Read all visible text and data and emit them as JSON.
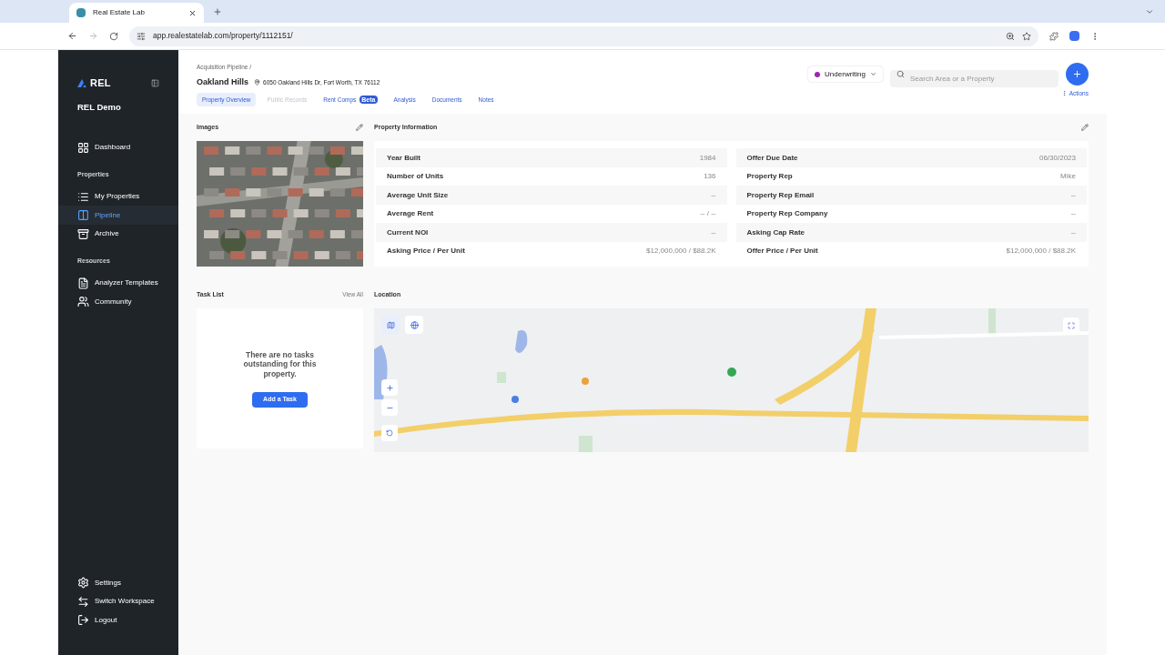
{
  "browser": {
    "tab_title": "Real Estate Lab",
    "url": "app.realestatelab.com/property/1112151/"
  },
  "sidebar": {
    "logo": "REL",
    "workspace": "REL Demo",
    "sections": [
      {
        "items": [
          {
            "label": "Dashboard",
            "selected": false
          }
        ]
      },
      {
        "title": "Properties",
        "items": [
          {
            "label": "My Properties",
            "selected": false
          },
          {
            "label": "Pipeline",
            "selected": true
          },
          {
            "label": "Archive",
            "selected": false
          }
        ]
      },
      {
        "title": "Resources",
        "items": [
          {
            "label": "Analyzer Templates",
            "selected": false
          },
          {
            "label": "Community",
            "selected": false
          }
        ]
      }
    ],
    "bottom": [
      {
        "label": "Settings"
      },
      {
        "label": "Switch Workspace"
      },
      {
        "label": "Logout"
      }
    ]
  },
  "header": {
    "breadcrumb": "Acquisition Pipeline /",
    "title": "Oakland Hills",
    "address": "6050 Oakland Hills Dr, Fort Worth, TX 76112",
    "status": {
      "label": "Underwriting",
      "color": "#9c27b0"
    },
    "search": {
      "placeholder": "Search Area or a Property"
    },
    "actions": "Actions",
    "tabs": [
      {
        "label": "Property Overview",
        "selected": true,
        "disabled": false
      },
      {
        "label": "Public Records",
        "selected": false,
        "disabled": true
      },
      {
        "label": "Rent Comps",
        "badge": "Beta",
        "selected": false,
        "disabled": false
      },
      {
        "label": "Analysis",
        "selected": false,
        "disabled": false
      },
      {
        "label": "Documents",
        "selected": false,
        "disabled": false
      },
      {
        "label": "Notes",
        "selected": false,
        "disabled": false
      }
    ]
  },
  "images": {
    "title": "Images"
  },
  "property_information": {
    "title": "Property Information",
    "left": [
      {
        "label": "Year Built",
        "value": "1984"
      },
      {
        "label": "Number of Units",
        "value": "136"
      },
      {
        "label": "Average Unit Size",
        "value": "--"
      },
      {
        "label": "Average Rent",
        "value": "-- / --"
      },
      {
        "label": "Current NOI",
        "value": "--"
      },
      {
        "label": "Asking Price / Per Unit",
        "value": "$12,000,000 / $88.2K"
      }
    ],
    "right": [
      {
        "label": "Offer Due Date",
        "value": "06/30/2023"
      },
      {
        "label": "Property Rep",
        "value": "Mike"
      },
      {
        "label": "Property Rep Email",
        "value": "--"
      },
      {
        "label": "Property Rep Company",
        "value": "--"
      },
      {
        "label": "Asking Cap Rate",
        "value": "--"
      },
      {
        "label": "Offer Price / Per Unit",
        "value": "$12,000,000 / $88.2K"
      }
    ]
  },
  "task_list": {
    "title": "Task List",
    "view_all": "View All",
    "empty_message": "There are no tasks outstanding for this property.",
    "add_button": "Add a Task"
  },
  "location": {
    "title": "Location"
  }
}
